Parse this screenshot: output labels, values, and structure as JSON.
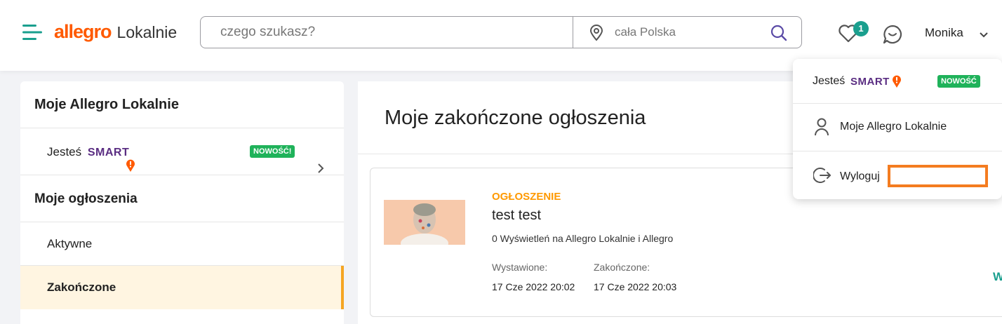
{
  "header": {
    "logo_brand": "allegro",
    "logo_sub": "Lokalnie",
    "search_placeholder": "czego szukasz?",
    "location_text": "cała Polska",
    "favorites_count": "1",
    "user_name": "Monika",
    "icons": [
      "menu-icon",
      "location-pin-icon",
      "search-icon",
      "heart-icon",
      "chat-icon",
      "chevron-down-icon"
    ]
  },
  "sidebar": {
    "title": "Moje Allegro Lokalnie",
    "smart_row": {
      "prefix": "Jesteś",
      "smart": "SMART",
      "badge": "NOWOŚĆ!"
    },
    "section_title": "Moje ogłoszenia",
    "items": [
      {
        "label": "Aktywne",
        "active": false
      },
      {
        "label": "Zakończone",
        "active": true
      }
    ]
  },
  "main": {
    "title": "Moje zakończone ogłoszenia",
    "listing": {
      "type": "OGŁOSZENIE",
      "title": "test test",
      "views": "0 Wyświetleń na Allegro Lokalnie i Allegro",
      "posted_label": "Wystawione:",
      "posted_value": "17 Cze 2022 20:02",
      "ended_label": "Zakończone:",
      "ended_value": "17 Cze 2022 20:03",
      "action_cut": "W"
    }
  },
  "dropdown": {
    "smart_prefix": "Jesteś",
    "smart": "SMART",
    "smart_badge": "NOWOŚĆ",
    "my_account": "Moje Allegro Lokalnie",
    "logout": "Wyloguj"
  },
  "colors": {
    "brand_orange": "#ff5a00",
    "teal": "#1a9f8e",
    "smart_purple": "#5a2d82",
    "new_badge_green": "#1fb25a",
    "active_item_bg": "#fff5e1",
    "active_item_bar": "#f5a623",
    "highlight_orange": "#f47c20"
  }
}
